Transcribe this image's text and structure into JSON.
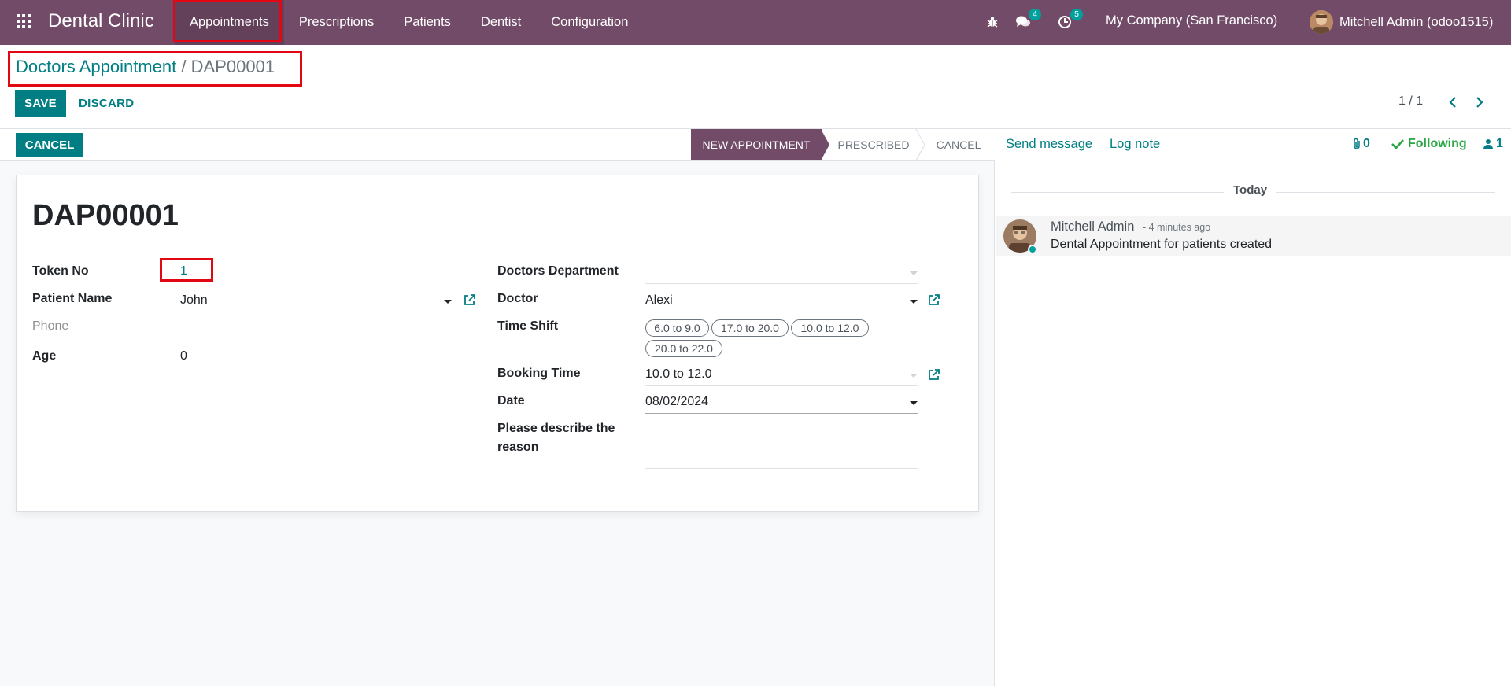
{
  "navbar": {
    "brand": "Dental Clinic",
    "menu": [
      {
        "label": "Appointments"
      },
      {
        "label": "Prescriptions"
      },
      {
        "label": "Patients"
      },
      {
        "label": "Dentist"
      },
      {
        "label": "Configuration"
      }
    ],
    "icons": [
      "bug-icon",
      "chat-icon",
      "activity-clock-icon"
    ],
    "chat_badge": "4",
    "activity_badge": "5",
    "company": "My Company (San Francisco)",
    "user": "Mitchell Admin (odoo1515)"
  },
  "breadcrumb": {
    "parent": "Doctors Appointment",
    "separator": "/",
    "current": "DAP00001"
  },
  "toolbar": {
    "save_label": "SAVE",
    "discard_label": "DISCARD",
    "pager": "1 / 1"
  },
  "statusbar": {
    "cancel_label": "CANCEL",
    "stages": [
      {
        "label": "NEW APPOINTMENT",
        "active": true
      },
      {
        "label": "PRESCRIBED",
        "active": false
      },
      {
        "label": "CANCEL",
        "active": false
      }
    ]
  },
  "form": {
    "title": "DAP00001",
    "token_no": {
      "label": "Token No",
      "value": "1"
    },
    "patient_name": {
      "label": "Patient Name",
      "value": "John"
    },
    "phone": {
      "label": "Phone",
      "value": ""
    },
    "age": {
      "label": "Age",
      "value": "0"
    },
    "doctors_department": {
      "label": "Doctors Department",
      "value": ""
    },
    "doctor": {
      "label": "Doctor",
      "value": "Alexi"
    },
    "time_shift": {
      "label": "Time Shift",
      "tags": [
        "6.0 to 9.0",
        "17.0 to 20.0",
        "10.0 to 12.0",
        "20.0 to 22.0"
      ]
    },
    "booking_time": {
      "label": "Booking Time",
      "value": "10.0 to 12.0"
    },
    "date": {
      "label": "Date",
      "value": "08/02/2024"
    },
    "reason": {
      "label_line1": "Please describe the",
      "label_line2": "reason",
      "value": ""
    }
  },
  "chatter": {
    "send_message": "Send message",
    "log_note": "Log note",
    "attachments_count": "0",
    "following": "Following",
    "followers_count": "1",
    "date_separator": "Today",
    "messages": [
      {
        "author": "Mitchell Admin",
        "time": "- 4 minutes ago",
        "body": "Dental Appointment for patients created"
      }
    ]
  },
  "colors": {
    "brand_purple": "#714b67",
    "accent_teal": "#017e84",
    "highlight_red": "#e30613"
  }
}
